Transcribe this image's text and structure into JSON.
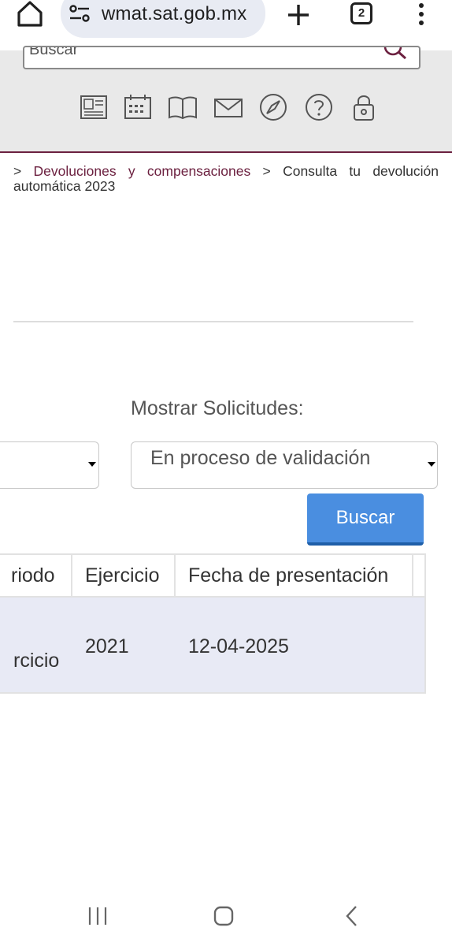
{
  "browser": {
    "url": "wmat.sat.gob.mx",
    "tab_count": "2",
    "icons": [
      "home-icon",
      "site-info-icon",
      "plus-icon",
      "tabs-icon",
      "more-vert-icon"
    ]
  },
  "header": {
    "search_placeholder": "Buscar",
    "nav_icons": [
      "news-icon",
      "calendar-icon",
      "book-icon",
      "mail-icon",
      "compass-icon",
      "help-icon",
      "lock-icon"
    ],
    "accent_color": "#6c2140"
  },
  "breadcrumb": {
    "sep1": ">",
    "link": "Devoluciones y compensaciones",
    "sep2": ">",
    "current": "Consulta tu devolución automática 2023"
  },
  "filters": {
    "mostrar_label": "Mostrar Solicitudes:",
    "left_select_value": "",
    "status_select_value": "En proceso de validación",
    "search_button": "Buscar",
    "button_color": "#4a8ee0"
  },
  "table": {
    "headers": [
      "riodo",
      "Ejercicio",
      "Fecha de presentación"
    ],
    "rows": [
      {
        "periodo": "rcicio",
        "ejercicio": "2021",
        "fecha": "12-04-2025"
      }
    ],
    "row_color": "#e8eaf5"
  },
  "android_nav": {
    "icons": [
      "recent-apps-icon",
      "home-circle-icon",
      "back-icon"
    ]
  }
}
